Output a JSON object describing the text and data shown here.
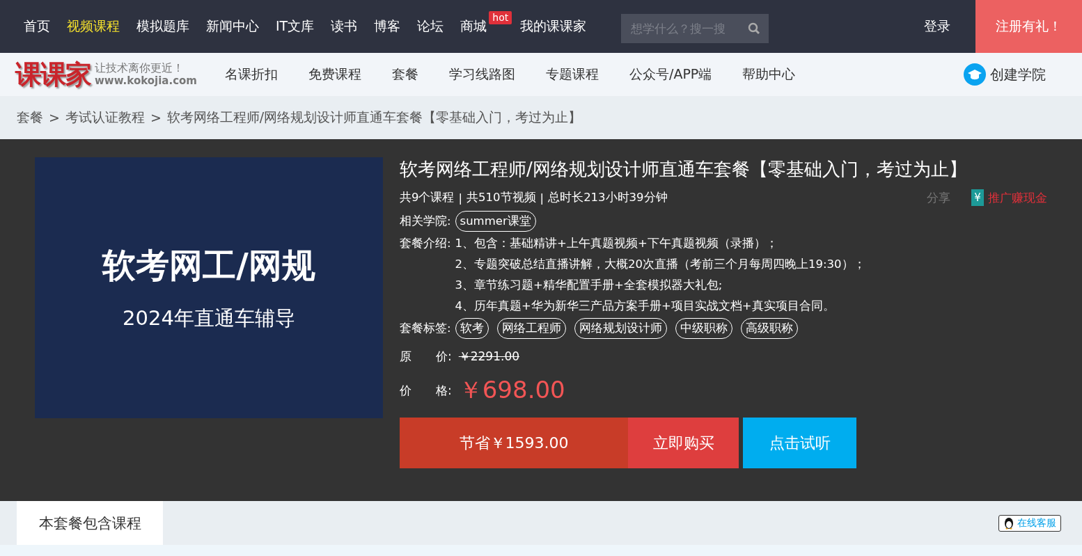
{
  "top_nav": {
    "items": [
      {
        "label": "首页",
        "selected": false
      },
      {
        "label": "视频课程",
        "selected": true
      },
      {
        "label": "模拟题库",
        "selected": false
      },
      {
        "label": "新闻中心",
        "selected": false
      },
      {
        "label": "IT文库",
        "selected": false
      },
      {
        "label": "读书",
        "selected": false
      },
      {
        "label": "博客",
        "selected": false
      },
      {
        "label": "论坛",
        "selected": false
      },
      {
        "label": "商城",
        "selected": false,
        "badge": "hot"
      },
      {
        "label": "我的课课家",
        "selected": false
      }
    ],
    "search": {
      "placeholder": "想学什么？搜一搜"
    },
    "login": "登录",
    "register": "注册有礼！"
  },
  "sub_nav": {
    "logo": {
      "name": "课课家",
      "slogan": "让技术离你更近！",
      "url": "www.kokojia.com"
    },
    "items": [
      "名课折扣",
      "免费课程",
      "套餐",
      "学习线路图",
      "专题课程",
      "公众号/APP端",
      "帮助中心"
    ],
    "create": "创建学院"
  },
  "breadcrumb": [
    "套餐",
    "考试认证教程",
    "软考网络工程师/网络规划设计师直通车套餐【零基础入门，考过为止】"
  ],
  "breadcrumb_sep": ">",
  "cover": {
    "title": "软考网工/网规",
    "subtitle": "2024年直通车辅导"
  },
  "package": {
    "title": "软考网络工程师/网络规划设计师直通车套餐【零基础入门，考过为止】",
    "stats": [
      "共9个课程",
      "共510节视频",
      "总时长213小时39分钟"
    ],
    "stats_sep": "|",
    "share": "分享",
    "promote_icon": "¥",
    "promote": "推广赚现金",
    "college_label": "相关学院:",
    "college": "summer课堂",
    "intro_label": "套餐介绍:",
    "intro": [
      "1、包含：基础精讲+上午真题视频+下午真题视频（录播）；",
      "2、专题突破总结直播讲解，大概20次直播（考前三个月每周四晚上19:30）；",
      "3、章节练习题+精华配置手册+全套模拟器大礼包;",
      "4、历年真题+华为新华三产品方案手册+项目实战文档+真实项目合同。"
    ],
    "tags_label": "套餐标签:",
    "tags": [
      "软考",
      "网络工程师",
      "网络规划设计师",
      "中级职称",
      "高级职称"
    ],
    "original_label": [
      "原",
      "价:"
    ],
    "original_price": "￥2291.00",
    "price_label": [
      "价",
      "格:"
    ],
    "price": "￥698.00",
    "save": "节省￥1593.00",
    "buy": "立即购买",
    "trial": "点击试听"
  },
  "section_tab": "本套餐包含课程",
  "service": "在线客服"
}
